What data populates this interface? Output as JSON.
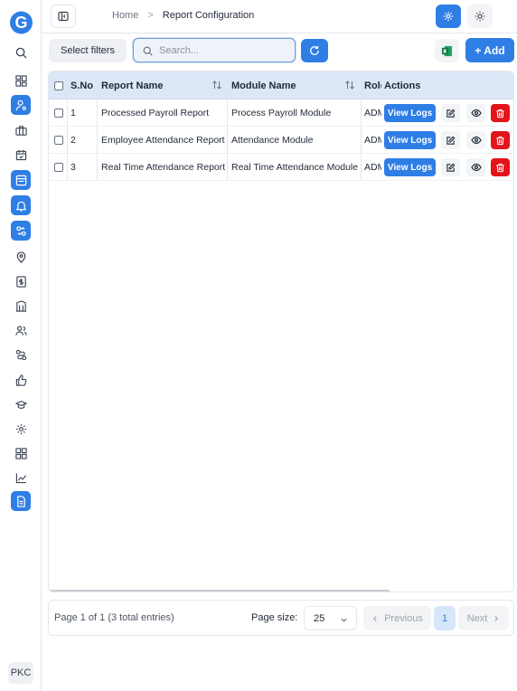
{
  "sidebar": {
    "logo_letter": "G",
    "avatar": "PKC"
  },
  "header": {
    "breadcrumb_home": "Home",
    "breadcrumb_separator": ">",
    "breadcrumb_current": "Report Configuration"
  },
  "toolbar": {
    "filters_label": "Select filters",
    "search_placeholder": "Search...",
    "add_label": "+ Add"
  },
  "table": {
    "columns": [
      "S.No",
      "Report Name",
      "Module Name",
      "Role",
      "Actions"
    ],
    "view_logs_label": "View Logs",
    "rows": [
      {
        "sno": "1",
        "report": "Processed Payroll Report",
        "module": "Process Payroll Module",
        "role": "ADMIN"
      },
      {
        "sno": "2",
        "report": "Employee Attendance Report",
        "module": "Attendance Module",
        "role": "ADMIN"
      },
      {
        "sno": "3",
        "report": "Real Time Attendance Report",
        "module": "Real Time Attendance Module",
        "role": "ADMIN"
      }
    ]
  },
  "pagination": {
    "info": "Page 1 of 1 (3 total entries)",
    "page_size_label": "Page size:",
    "page_size": "25",
    "previous_label": "Previous",
    "current_page": "1",
    "next_label": "Next"
  },
  "colors": {
    "primary": "#2f7ee6",
    "danger": "#e3141a",
    "header_bg": "#dbe7f7"
  }
}
